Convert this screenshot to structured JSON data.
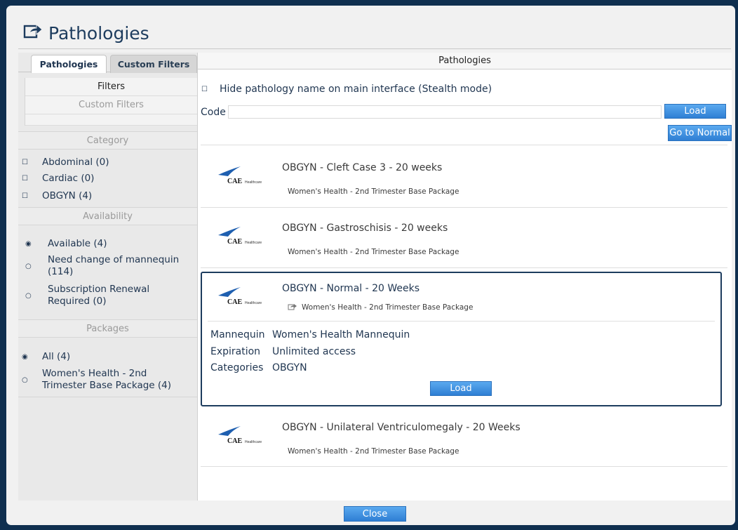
{
  "dialog": {
    "title": "Pathologies",
    "close_label": "Close"
  },
  "left": {
    "tabs": [
      "Pathologies",
      "Custom Filters"
    ],
    "subnav": {
      "filters": "Filters",
      "custom_filters": "Custom Filters",
      "category_header": "Category"
    },
    "categories": [
      "Abdominal (0)",
      "Cardiac (0)",
      "OBGYN (4)"
    ],
    "availability_header": "Availability",
    "availability": [
      {
        "label": "Available (4)",
        "selected": true
      },
      {
        "label": "Need change of mannequin (114)",
        "selected": false
      },
      {
        "label": "Subscription Renewal Required (0)",
        "selected": false
      }
    ],
    "packages_header": "Packages",
    "packages": [
      {
        "label": "All (4)",
        "selected": true
      },
      {
        "label": "Women's Health - 2nd Trimester Base Package (4)",
        "selected": false
      }
    ]
  },
  "right": {
    "header": "Pathologies",
    "stealth_label": "Hide pathology name on main interface (Stealth mode)",
    "code_label": "Code",
    "code_value": "",
    "load_label": "Load",
    "go_normal_label": "Go to Normal",
    "logo_text": "CAE",
    "logo_sub": "Healthcare",
    "items": [
      {
        "name": "OBGYN - Cleft Case 3 - 20 weeks",
        "package": "Women's Health - 2nd Trimester Base Package"
      },
      {
        "name": "OBGYN - Gastroschisis - 20 weeks",
        "package": "Women's Health - 2nd Trimester Base Package"
      },
      {
        "name": "OBGYN - Normal - 20 Weeks",
        "package": "Women's Health - 2nd Trimester Base Package",
        "details": {
          "mannequin_key": "Mannequin",
          "mannequin": "Women's Health Mannequin",
          "expiration_key": "Expiration",
          "expiration": "Unlimited access",
          "categories_key": "Categories",
          "categories": "OBGYN",
          "load_label": "Load"
        }
      },
      {
        "name": "OBGYN - Unilateral Ventriculomegaly - 20 Weeks",
        "package": "Women's Health - 2nd Trimester Base Package"
      }
    ]
  },
  "colors": {
    "accent": "#2f7fd4",
    "frame": "#0f2f4f",
    "text": "#1f3550"
  }
}
